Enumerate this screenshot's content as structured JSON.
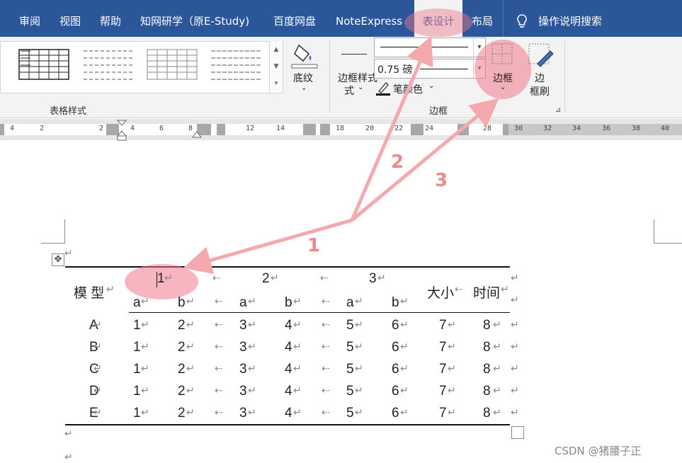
{
  "tabs": [
    "审阅",
    "视图",
    "帮助",
    "知网研学（原E-Study)",
    "百度网盘",
    "NoteExpress",
    "表设计",
    "布局"
  ],
  "search_label": "操作说明搜索",
  "ribbon": {
    "group_table_styles": "表格样式",
    "shading_label": "底纹",
    "border_styles_label": "边框样式",
    "border_styles_label_2": "式",
    "pen_weight": "0.75 磅",
    "pen_color_label": "笔颜色",
    "borders_label": "边框",
    "border_painter_line1": "边",
    "border_painter_line2": "框刷",
    "group_borders": "边框"
  },
  "ruler_ticks": [
    "4",
    "2",
    "2",
    "4",
    "6",
    "8",
    "12",
    "14",
    "18",
    "20",
    "22",
    "24",
    "28",
    "30",
    "32",
    "34",
    "36",
    "38",
    "40"
  ],
  "annotations": [
    "1",
    "2",
    "3"
  ],
  "table": {
    "head_model": "模 型",
    "group_headers": [
      "1",
      "2",
      "3"
    ],
    "head_size": "大小",
    "head_time": "时间",
    "sub_headers": [
      "a",
      "b",
      "a",
      "b",
      "a",
      "b"
    ],
    "rows": [
      [
        "A",
        "1",
        "2",
        "3",
        "4",
        "5",
        "6",
        "7",
        "8"
      ],
      [
        "B",
        "1",
        "2",
        "3",
        "4",
        "5",
        "6",
        "7",
        "8"
      ],
      [
        "C",
        "1",
        "2",
        "3",
        "4",
        "5",
        "6",
        "7",
        "8"
      ],
      [
        "D",
        "1",
        "2",
        "3",
        "4",
        "5",
        "6",
        "7",
        "8"
      ],
      [
        "E",
        "1",
        "2",
        "3",
        "4",
        "5",
        "6",
        "7",
        "8"
      ]
    ]
  },
  "watermark": "CSDN @猪腰子正",
  "colors": {
    "accent": "#2b579a",
    "highlight": "#f0a0a8",
    "arrow": "#f3a9ad"
  }
}
